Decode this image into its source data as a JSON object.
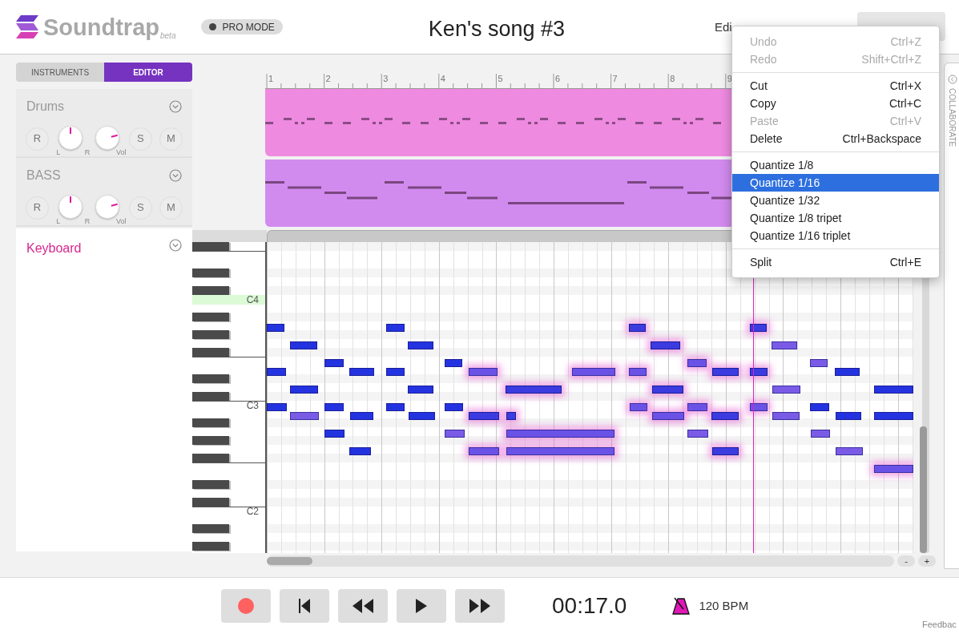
{
  "app": {
    "logo": "Soundtrap",
    "badge": "beta"
  },
  "pro_mode": {
    "label": "PRO MODE"
  },
  "song_title": "Ken's song #3",
  "header_menu": {
    "label": "Edi"
  },
  "panel_tabs": [
    {
      "label": "INSTRUMENTS",
      "selected": false
    },
    {
      "label": "EDITOR",
      "selected": true
    }
  ],
  "tracks": [
    {
      "name": "Drums",
      "record": "R",
      "pan_left": "L",
      "pan_right": "R",
      "volume_label": "Vol",
      "solo": "S",
      "mute": "M",
      "pan": {
        "level": 0.5
      },
      "volume": {
        "level": 0.78
      }
    },
    {
      "name": "BASS",
      "record": "R",
      "pan_left": "L",
      "pan_right": "R",
      "volume_label": "Vol",
      "solo": "S",
      "mute": "M",
      "pan": {
        "level": 0.5
      },
      "volume": {
        "level": 0.78
      }
    }
  ],
  "keyboard_track": {
    "name": "Keyboard"
  },
  "ruler": [
    "1",
    "2",
    "3",
    "4",
    "5",
    "6",
    "7",
    "8",
    "9"
  ],
  "key_labels": [
    {
      "label": "C4",
      "highlighted": true
    },
    {
      "label": "C3",
      "highlighted": false
    },
    {
      "label": "C2",
      "highlighted": false
    }
  ],
  "context_menu": {
    "groups": [
      [
        {
          "label": "Undo",
          "shortcut": "Ctrl+Z",
          "disabled": true,
          "selected": false
        },
        {
          "label": "Redo",
          "shortcut": "Shift+Ctrl+Z",
          "disabled": true,
          "selected": false
        }
      ],
      [
        {
          "label": "Cut",
          "shortcut": "Ctrl+X",
          "disabled": false,
          "selected": false
        },
        {
          "label": "Copy",
          "shortcut": "Ctrl+C",
          "disabled": false,
          "selected": false
        },
        {
          "label": "Paste",
          "shortcut": "Ctrl+V",
          "disabled": true,
          "selected": false
        },
        {
          "label": "Delete",
          "shortcut": "Ctrl+Backspace",
          "disabled": false,
          "selected": false
        }
      ],
      [
        {
          "label": "Quantize 1/8",
          "disabled": false,
          "selected": false
        },
        {
          "label": "Quantize 1/16",
          "disabled": false,
          "selected": true
        },
        {
          "label": "Quantize 1/32",
          "disabled": false,
          "selected": false
        },
        {
          "label": "Quantize 1/8 tripet",
          "disabled": false,
          "selected": false
        },
        {
          "label": "Quantize 1/16 triplet",
          "disabled": false,
          "selected": false
        }
      ],
      [
        {
          "label": "Split",
          "shortcut": "Ctrl+E",
          "disabled": false,
          "selected": false
        }
      ]
    ]
  },
  "collaborate": "COLLABORATE",
  "zoom_buttons": [
    "-",
    "+"
  ],
  "transport": [
    {
      "kind": "record"
    },
    {
      "kind": "to-start"
    },
    {
      "kind": "rewind"
    },
    {
      "kind": "play"
    },
    {
      "kind": "forward"
    }
  ],
  "time": "00:17.0",
  "tempo": "120 BPM",
  "feedback": "Feedbac"
}
